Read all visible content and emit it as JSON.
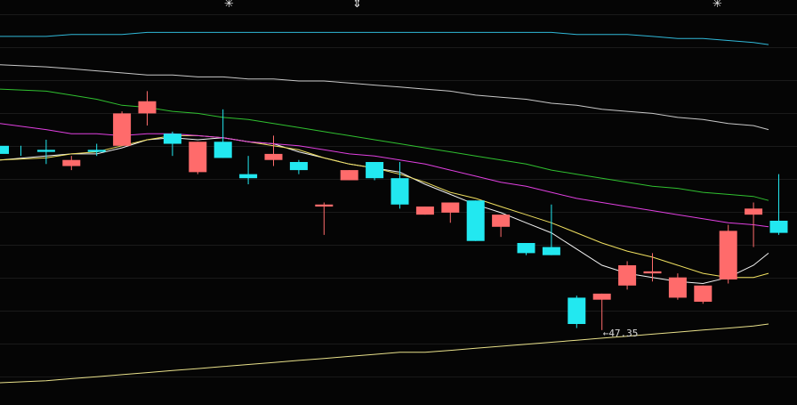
{
  "chart_data": {
    "type": "candlestick",
    "y_range": [
      39.5,
      59.5
    ],
    "grid": true,
    "low_annotation": "47.35",
    "top_markers": [
      "✳",
      "⇕",
      "✳"
    ],
    "colors": {
      "background": "#050505",
      "grid": "#1a1a1a",
      "up": "#ff6b6b",
      "down": "#22e8f0",
      "ma_white": "#f2f2f2",
      "ma_yellow": "#f0e060",
      "ma_magenta": "#e040e0",
      "ma_green": "#30c030",
      "ma_gray": "#c8c8c8",
      "ma_cyan": "#30b8d8",
      "bottom_line": "#e8e08a"
    },
    "candles": [
      {
        "o": 52.3,
        "c": 51.9,
        "h": 52.3,
        "l": 51.8
      },
      {
        "o": 52.1,
        "c": 52.0,
        "h": 52.6,
        "l": 51.4
      },
      {
        "o": 51.3,
        "c": 51.6,
        "h": 51.8,
        "l": 51.1
      },
      {
        "o": 52.1,
        "c": 52.0,
        "h": 52.4,
        "l": 51.8
      },
      {
        "o": 52.3,
        "c": 53.9,
        "h": 54.0,
        "l": 52.3
      },
      {
        "o": 53.9,
        "c": 54.5,
        "h": 55.0,
        "l": 53.3
      },
      {
        "o": 52.9,
        "c": 52.4,
        "h": 53.0,
        "l": 51.8
      },
      {
        "o": 51.0,
        "c": 52.5,
        "h": 52.5,
        "l": 50.9
      },
      {
        "o": 52.5,
        "c": 51.7,
        "h": 54.1,
        "l": 51.7
      },
      {
        "o": 50.9,
        "c": 50.7,
        "h": 51.8,
        "l": 50.4
      },
      {
        "o": 51.6,
        "c": 51.9,
        "h": 52.8,
        "l": 51.3
      },
      {
        "o": 51.5,
        "c": 51.1,
        "h": 51.6,
        "l": 50.9
      },
      {
        "o": 49.3,
        "c": 49.4,
        "h": 49.5,
        "l": 47.9
      },
      {
        "o": 50.6,
        "c": 51.1,
        "h": 51.1,
        "l": 50.6
      },
      {
        "o": 51.5,
        "c": 50.7,
        "h": 51.5,
        "l": 50.6
      },
      {
        "o": 50.7,
        "c": 49.4,
        "h": 51.5,
        "l": 49.2
      },
      {
        "o": 48.9,
        "c": 49.3,
        "h": 49.3,
        "l": 48.9
      },
      {
        "o": 49.0,
        "c": 49.5,
        "h": 49.5,
        "l": 48.5
      },
      {
        "o": 49.6,
        "c": 47.6,
        "h": 49.6,
        "l": 47.6
      },
      {
        "o": 48.3,
        "c": 48.9,
        "h": 48.9,
        "l": 47.8
      },
      {
        "o": 47.5,
        "c": 47.0,
        "h": 47.5,
        "l": 46.9
      },
      {
        "o": 47.3,
        "c": 46.9,
        "h": 49.4,
        "l": 46.9
      },
      {
        "o": 44.8,
        "c": 43.5,
        "h": 44.9,
        "l": 43.3
      },
      {
        "o": 44.7,
        "c": 45.0,
        "h": 45.0,
        "l": 43.2
      },
      {
        "o": 45.4,
        "c": 46.4,
        "h": 46.6,
        "l": 45.2
      },
      {
        "o": 46.0,
        "c": 46.1,
        "h": 47.0,
        "l": 45.6
      },
      {
        "o": 44.8,
        "c": 45.8,
        "h": 46.0,
        "l": 44.7
      },
      {
        "o": 44.6,
        "c": 45.4,
        "h": 45.4,
        "l": 44.5
      },
      {
        "o": 45.7,
        "c": 48.1,
        "h": 48.4,
        "l": 45.5
      },
      {
        "o": 48.9,
        "c": 49.2,
        "h": 49.5,
        "l": 47.3
      },
      {
        "o": 48.6,
        "c": 48.0,
        "h": 50.9,
        "l": 47.9
      }
    ],
    "ma_lines": [
      {
        "key": "ma_white",
        "values": [
          51.6,
          51.8,
          51.9,
          51.9,
          52.2,
          52.6,
          52.7,
          52.6,
          52.7,
          52.5,
          52.4,
          52.0,
          51.7,
          51.4,
          51.2,
          51.0,
          50.4,
          49.9,
          49.4,
          49.0,
          48.5,
          48.0,
          47.2,
          46.4,
          46.0,
          45.8,
          45.6,
          45.5,
          45.8,
          46.4,
          47.0
        ]
      },
      {
        "key": "ma_yellow",
        "values": [
          51.6,
          51.7,
          51.9,
          52.0,
          52.3,
          52.6,
          52.8,
          52.8,
          52.7,
          52.5,
          52.3,
          52.1,
          51.7,
          51.4,
          51.2,
          50.9,
          50.5,
          50.0,
          49.7,
          49.3,
          48.9,
          48.5,
          48.0,
          47.5,
          47.1,
          46.8,
          46.4,
          46.0,
          45.8,
          45.8,
          46.0
        ]
      },
      {
        "key": "ma_magenta",
        "values": [
          53.4,
          53.1,
          52.9,
          52.9,
          52.8,
          52.9,
          52.9,
          52.8,
          52.7,
          52.5,
          52.4,
          52.3,
          52.1,
          51.9,
          51.8,
          51.6,
          51.4,
          51.1,
          50.8,
          50.5,
          50.3,
          50.0,
          49.7,
          49.5,
          49.3,
          49.1,
          48.9,
          48.7,
          48.5,
          48.4,
          48.3
        ]
      },
      {
        "key": "ma_green",
        "values": [
          55.1,
          55.0,
          54.8,
          54.6,
          54.3,
          54.2,
          54.0,
          53.9,
          53.7,
          53.6,
          53.4,
          53.2,
          53.0,
          52.8,
          52.6,
          52.4,
          52.2,
          52.0,
          51.8,
          51.6,
          51.4,
          51.1,
          50.9,
          50.7,
          50.5,
          50.3,
          50.2,
          50.0,
          49.9,
          49.8,
          49.6
        ]
      },
      {
        "key": "ma_gray",
        "values": [
          56.3,
          56.2,
          56.1,
          56.0,
          55.9,
          55.8,
          55.8,
          55.7,
          55.7,
          55.6,
          55.6,
          55.5,
          55.5,
          55.4,
          55.3,
          55.2,
          55.1,
          55.0,
          54.8,
          54.7,
          54.6,
          54.4,
          54.3,
          54.1,
          54.0,
          53.9,
          53.7,
          53.6,
          53.4,
          53.3,
          53.1
        ]
      },
      {
        "key": "ma_cyan",
        "values": [
          57.7,
          57.7,
          57.8,
          57.8,
          57.8,
          57.9,
          57.9,
          57.9,
          57.9,
          57.9,
          57.9,
          57.9,
          57.9,
          57.9,
          57.9,
          57.9,
          57.9,
          57.9,
          57.9,
          57.9,
          57.9,
          57.9,
          57.8,
          57.8,
          57.8,
          57.7,
          57.6,
          57.6,
          57.5,
          57.4,
          57.3
        ]
      },
      {
        "key": "bottom_line",
        "values": [
          40.6,
          40.7,
          40.8,
          40.9,
          41.0,
          41.1,
          41.2,
          41.3,
          41.4,
          41.5,
          41.6,
          41.7,
          41.8,
          41.9,
          42.0,
          42.1,
          42.1,
          42.2,
          42.3,
          42.4,
          42.5,
          42.6,
          42.7,
          42.8,
          42.9,
          43.0,
          43.1,
          43.2,
          43.3,
          43.4,
          43.5
        ]
      }
    ]
  }
}
